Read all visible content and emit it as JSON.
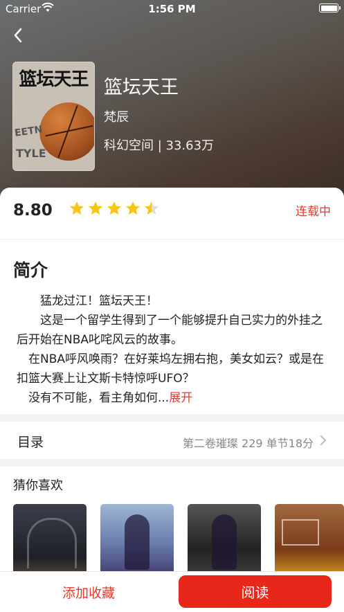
{
  "status_bar": {
    "carrier": "Carrier",
    "time": "1:56 PM"
  },
  "book": {
    "title": "篮坛天王",
    "cover_title": "篮坛天王",
    "cover_text_1": "EETN",
    "cover_text_2": "TYLE",
    "author": "梵辰",
    "meta": "科幻空间 | 33.63万",
    "score": "8.80",
    "rating_stars": 4.5,
    "serial_status": "连载中"
  },
  "intro": {
    "title": "简介",
    "lines": [
      "　　猛龙过江！篮坛天王！",
      "　　这是一个留学生得到了一个能够提升自己实力的外挂之后开始在NBA叱咤风云的故事。",
      "　在NBA呼风唤雨？在好莱坞左拥右抱，美女如云？或是在扣篮大赛上让文斯卡特惊呼UFO？",
      "　没有不可能，看主角如何..."
    ],
    "expand_label": "展开"
  },
  "toc": {
    "label": "目录",
    "latest": "第二卷璀璨 229 单节18分"
  },
  "recommend": {
    "label": "猜你喜欢"
  },
  "actions": {
    "favorite_label": "添加收藏",
    "read_label": "阅读"
  },
  "colors": {
    "accent": "#e8271b",
    "star": "#f5c518"
  }
}
